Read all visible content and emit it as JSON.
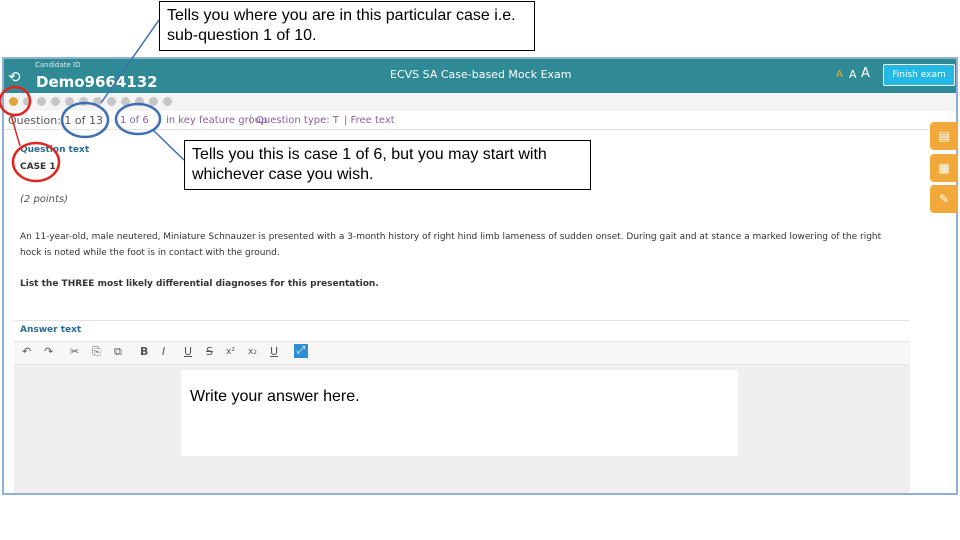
{
  "header": {
    "candidate_label": "Candidate ID",
    "candidate_id": "Demo9664132",
    "exam_title": "ECVS SA Case-based Mock Exam",
    "font_size_small": "A",
    "font_size_medium": "A",
    "font_size_large": "A",
    "finish_label": "Finish exam",
    "logout_icon": "logout-icon"
  },
  "info": {
    "question_position": "Question: 1 of 13",
    "case_position": "1 of 6",
    "key_feature": "in key feature group",
    "question_type": "Question type: T",
    "separator": "|",
    "free_text": "| Free text"
  },
  "question": {
    "heading": "Question text",
    "case": "CASE 1",
    "points": "(2 points)",
    "stem": "An 11-year-old, male neutered, Miniature Schnauzer is presented with a 3-month history of right hind limb lameness of sudden onset. During gait and at stance a marked lowering of the right hock is noted while the foot is in contact with the ground.",
    "instruction": "List the THREE most likely differential diagnoses for this presentation."
  },
  "answer": {
    "heading": "Answer text",
    "placeholder": "Write your answer here."
  },
  "toolbar": [
    "↶",
    "↷",
    "✂",
    "⎘",
    "⧉",
    "B",
    "I",
    "U",
    "S",
    "x²",
    "x₂",
    "U",
    "⤢"
  ],
  "side_buttons": [
    "notes-icon",
    "calculator-icon",
    "pencil-icon"
  ],
  "callouts": {
    "sub_question": "Tells you where you are in this particular case i.e. sub-question 1 of 10.",
    "case_number": "Tells you this is case 1 of 6, but you may start with whichever case you wish."
  },
  "colors": {
    "topbar": "#2f8a95",
    "finish": "#23b9e4",
    "accent": "#f2a93b",
    "link": "#8b5ea3",
    "annotation_red": "#e0261f",
    "annotation_blue": "#3d6fb4"
  }
}
